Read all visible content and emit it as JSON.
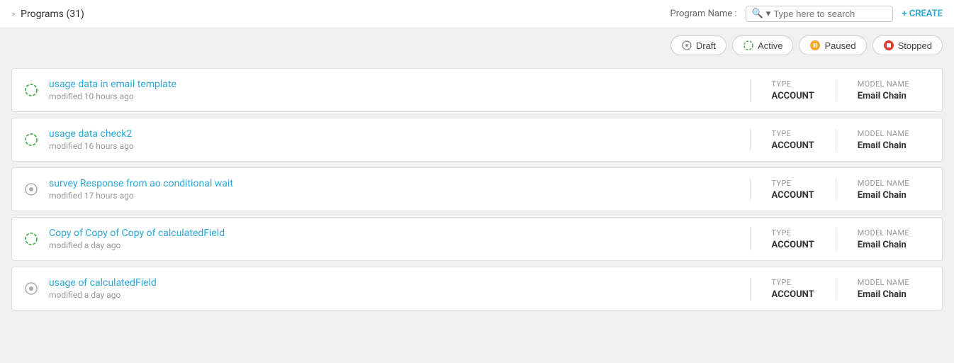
{
  "header": {
    "chevron": "»",
    "title": "Programs (31)",
    "program_name_label": "Program Name :",
    "search_placeholder": "Type here to search",
    "create_label": "+ CREATE"
  },
  "filters": {
    "buttons": [
      {
        "id": "draft",
        "label": "Draft",
        "dot_class": "dot-draft",
        "icon": "draft"
      },
      {
        "id": "active",
        "label": "Active",
        "dot_class": "dot-active",
        "icon": "active"
      },
      {
        "id": "paused",
        "label": "Paused",
        "dot_class": "dot-paused",
        "icon": "paused"
      },
      {
        "id": "stopped",
        "label": "Stopped",
        "dot_class": "dot-stopped",
        "icon": "stopped"
      }
    ]
  },
  "programs": [
    {
      "id": 1,
      "name": "usage data in email template",
      "modified": "modified 10 hours ago",
      "type_label": "Type",
      "type_value": "ACCOUNT",
      "model_label": "Model Name",
      "model_value": "Email Chain",
      "status": "active"
    },
    {
      "id": 2,
      "name": "usage data check2",
      "modified": "modified 16 hours ago",
      "type_label": "Type",
      "type_value": "ACCOUNT",
      "model_label": "Model Name",
      "model_value": "Email Chain",
      "status": "active"
    },
    {
      "id": 3,
      "name": "survey Response from ao conditional wait",
      "modified": "modified 17 hours ago",
      "type_label": "Type",
      "type_value": "ACCOUNT",
      "model_label": "Model Name",
      "model_value": "Email Chain",
      "status": "draft"
    },
    {
      "id": 4,
      "name": "Copy of Copy of Copy of calculatedField",
      "modified": "modified a day ago",
      "type_label": "Type",
      "type_value": "ACCOUNT",
      "model_label": "Model Name",
      "model_value": "Email Chain",
      "status": "active"
    },
    {
      "id": 5,
      "name": "usage of calculatedField",
      "modified": "modified a day ago",
      "type_label": "Type",
      "type_value": "ACCOUNT",
      "model_label": "Model Name",
      "model_value": "Email Chain",
      "status": "draft"
    }
  ]
}
